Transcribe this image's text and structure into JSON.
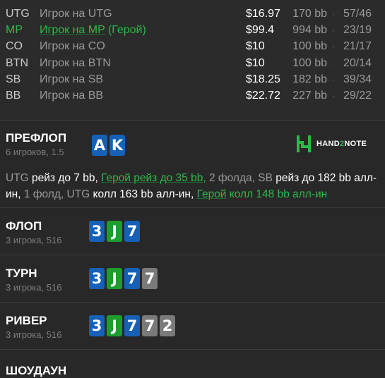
{
  "players": [
    {
      "pos": "UTG",
      "name": "Игрок на UTG",
      "tag": "",
      "stack": "$16.97",
      "bb": "170 bb",
      "dot": "·",
      "count": "57/46",
      "hero": false
    },
    {
      "pos": "MP",
      "name": "Игрок на MP",
      "tag": " (Герой)",
      "stack": "$99.4",
      "bb": "994 bb",
      "dot": "·",
      "count": "23/19",
      "hero": true
    },
    {
      "pos": "CO",
      "name": "Игрок на CO",
      "tag": "",
      "stack": "$10",
      "bb": "100 bb",
      "dot": "·",
      "count": "21/17",
      "hero": false
    },
    {
      "pos": "BTN",
      "name": "Игрок на BTN",
      "tag": "",
      "stack": "$10",
      "bb": "100 bb",
      "dot": "·",
      "count": "20/14",
      "hero": false
    },
    {
      "pos": "SB",
      "name": "Игрок на SB",
      "tag": "",
      "stack": "$18.25",
      "bb": "182 bb",
      "dot": "·",
      "count": "39/34",
      "hero": false
    },
    {
      "pos": "BB",
      "name": "Игрок на BB",
      "tag": "",
      "stack": "$22.72",
      "bb": "227 bb",
      "dot": "·",
      "count": "29/22",
      "hero": false
    }
  ],
  "logo": {
    "text_a": "HAND",
    "text_b": "2",
    "text_c": "NOTE"
  },
  "preflop": {
    "title": "ПРЕФЛОП",
    "sub": "6 игроков, 1.5",
    "cards": [
      {
        "rank": "A",
        "color": "blue"
      },
      {
        "rank": "K",
        "color": "blue"
      }
    ],
    "actions": [
      {
        "text": "UTG",
        "cls": "muted"
      },
      {
        "text": " рейз до 7 bb, ",
        "cls": ""
      },
      {
        "text": "Герой рейз до 35 bb,",
        "cls": "hero ul"
      },
      {
        "text": " 2 фолда, SB",
        "cls": "muted"
      },
      {
        "text": " рейз до 182 bb алл-ин, ",
        "cls": ""
      },
      {
        "text": "1 фолд, UTG",
        "cls": "muted"
      },
      {
        "text": " колл 163 bb алл-ин, ",
        "cls": ""
      },
      {
        "text": "Герой",
        "cls": "hero ul"
      },
      {
        "text": " колл 148 bb алл-ин",
        "cls": "hero"
      }
    ]
  },
  "flop": {
    "title": "ФЛОП",
    "sub": "3 игрока, 516",
    "cards": [
      {
        "rank": "3",
        "color": "blue"
      },
      {
        "rank": "J",
        "color": "green"
      },
      {
        "rank": "7",
        "color": "blue"
      }
    ]
  },
  "turn": {
    "title": "ТУРН",
    "sub": "3 игрока, 516",
    "cards": [
      {
        "rank": "3",
        "color": "blue"
      },
      {
        "rank": "J",
        "color": "green"
      },
      {
        "rank": "7",
        "color": "blue"
      },
      {
        "rank": "7",
        "color": "gray"
      }
    ]
  },
  "river": {
    "title": "РИВЕР",
    "sub": "3 игрока, 516",
    "cards": [
      {
        "rank": "3",
        "color": "blue"
      },
      {
        "rank": "J",
        "color": "green"
      },
      {
        "rank": "7",
        "color": "blue"
      },
      {
        "rank": "7",
        "color": "gray"
      },
      {
        "rank": "2",
        "color": "gray"
      }
    ]
  },
  "showdown": {
    "title": "ШОУДАУН"
  }
}
